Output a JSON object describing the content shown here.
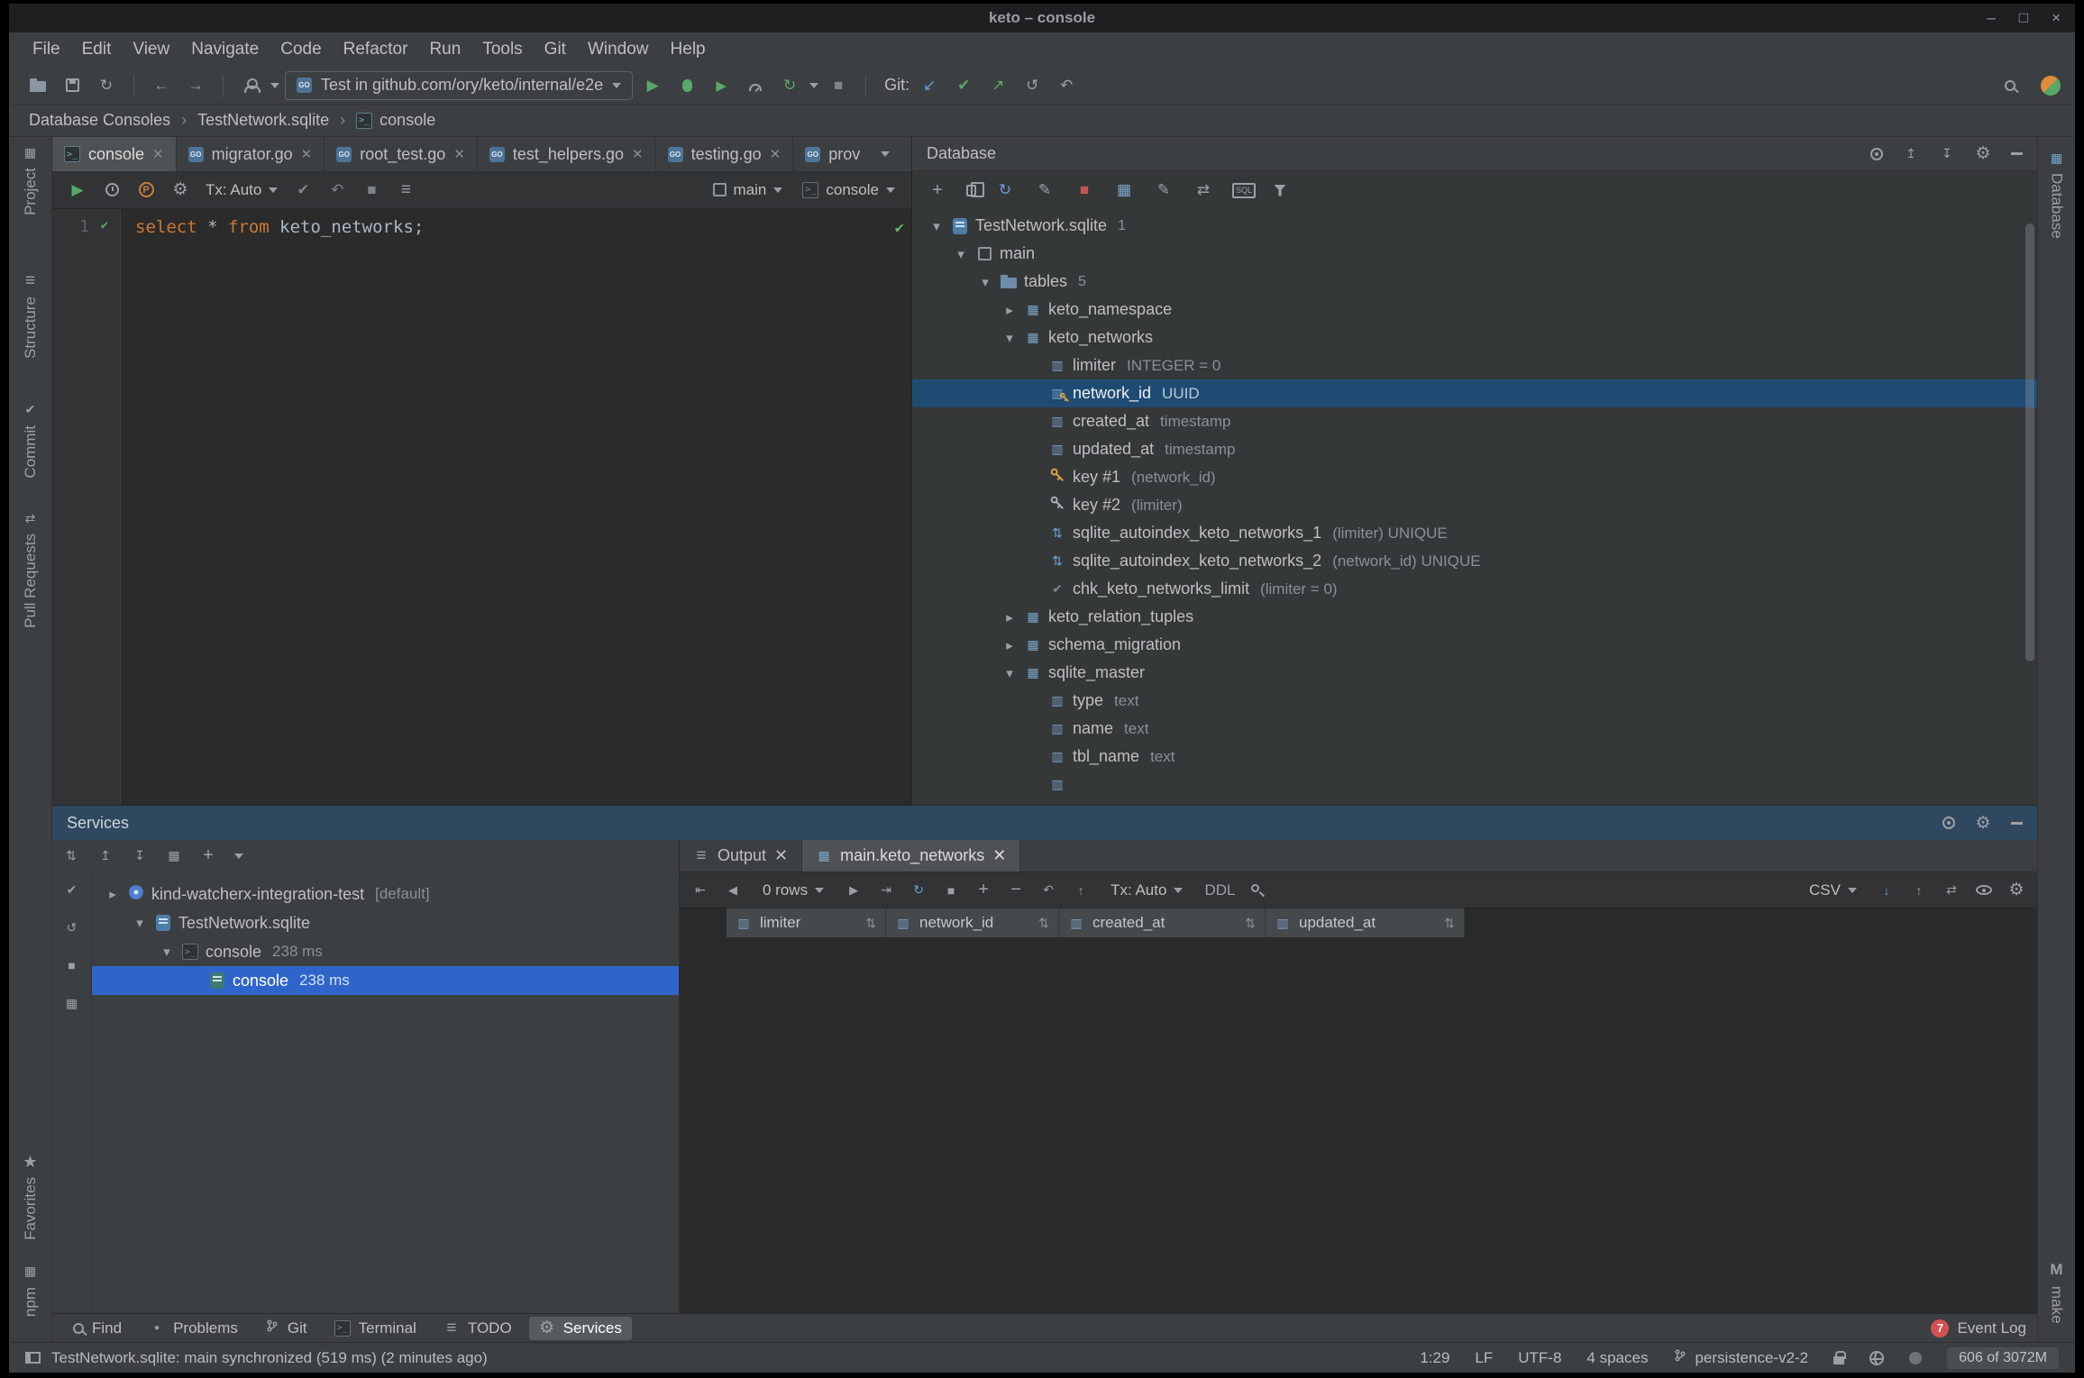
{
  "window": {
    "title": "keto – console",
    "controls": [
      "minimize",
      "maximize",
      "close"
    ]
  },
  "colors": {
    "selection_blue": "#2f65ca",
    "db_selection": "#1f4b73",
    "keyword_orange": "#cc7832",
    "success_green": "#59a869",
    "error_red": "#d25252",
    "key_gold": "#d9a343",
    "icon_blue": "#6a9fd8"
  },
  "menu": {
    "items": [
      "File",
      "Edit",
      "View",
      "Navigate",
      "Code",
      "Refactor",
      "Run",
      "Tools",
      "Git",
      "Window",
      "Help"
    ]
  },
  "toolbar": {
    "run_config": "Test in github.com/ory/keto/internal/e2e",
    "git_label": "Git:",
    "icon_names_left": [
      "open-icon",
      "save-all-icon",
      "sync-icon",
      "back-icon",
      "forward-icon",
      "profile-icon"
    ],
    "icon_names_run": [
      "run-icon",
      "debug-icon",
      "coverage-icon",
      "profiler-icon",
      "rerun-icon",
      "stop-icon"
    ],
    "icon_names_git": [
      "update-project-icon",
      "commit-icon",
      "push-icon",
      "history-icon",
      "rollback-icon"
    ],
    "icon_names_right": [
      "search-everywhere-icon",
      "avatar"
    ]
  },
  "breadcrumb": {
    "items": [
      "Database Consoles",
      "TestNetwork.sqlite",
      "console"
    ]
  },
  "left_stripe": {
    "items": [
      "Project",
      "Structure",
      "Commit",
      "Pull Requests"
    ],
    "bottom_items": [
      "Favorites",
      "npm"
    ]
  },
  "right_stripe": {
    "items": [
      "Database"
    ],
    "bottom_items": [
      "make"
    ]
  },
  "editor": {
    "tabs": [
      {
        "label": "console"
      },
      {
        "label": "migrator.go"
      },
      {
        "label": "root_test.go"
      },
      {
        "label": "test_helpers.go"
      },
      {
        "label": "testing.go"
      },
      {
        "label": "prov"
      }
    ],
    "toolbar": {
      "tx": "Tx: Auto",
      "schema": "main",
      "session": "console"
    },
    "code": {
      "line_number": "1",
      "kw1": "select ",
      "star": "* ",
      "kw2": "from ",
      "rest": "keto_networks;"
    }
  },
  "database": {
    "title": "Database",
    "toolbar_icon_names": [
      "add-icon",
      "copy-icon",
      "refresh-icon",
      "edit-icon",
      "stop-icon",
      "data-editor-icon",
      "modify-icon",
      "jump-to-console-icon",
      "sql-generator-icon",
      "filter-icon"
    ],
    "header_icon_names": [
      "tool-window-options-icon",
      "expand-all-icon",
      "collapse-all-icon",
      "settings-icon",
      "hide-icon"
    ],
    "tree": [
      {
        "name": "TestNetwork.sqlite",
        "badge": "1"
      },
      {
        "name": "main"
      },
      {
        "name": "tables",
        "badge": "5"
      },
      {
        "name": "keto_namespace"
      },
      {
        "name": "keto_networks"
      },
      {
        "name": "limiter",
        "meta": "INTEGER = 0"
      },
      {
        "name": "network_id",
        "meta": "UUID"
      },
      {
        "name": "created_at",
        "meta": "timestamp"
      },
      {
        "name": "updated_at",
        "meta": "timestamp"
      },
      {
        "name": "key #1",
        "meta": "(network_id)"
      },
      {
        "name": "key #2",
        "meta": "(limiter)"
      },
      {
        "name": "sqlite_autoindex_keto_networks_1",
        "meta": "(limiter) UNIQUE"
      },
      {
        "name": "sqlite_autoindex_keto_networks_2",
        "meta": "(network_id) UNIQUE"
      },
      {
        "name": "chk_keto_networks_limit",
        "meta": "(limiter = 0)"
      },
      {
        "name": "keto_relation_tuples"
      },
      {
        "name": "schema_migration"
      },
      {
        "name": "sqlite_master"
      },
      {
        "name": "type",
        "meta": "text"
      },
      {
        "name": "name",
        "meta": "text"
      },
      {
        "name": "tbl_name",
        "meta": "text"
      }
    ]
  },
  "services": {
    "title": "Services",
    "tree": [
      {
        "name": "kind-watcherx-integration-test",
        "meta": "[default]"
      },
      {
        "name": "TestNetwork.sqlite"
      },
      {
        "name": "console",
        "meta": "238 ms"
      },
      {
        "name": "console",
        "meta": "238 ms"
      }
    ],
    "output_tabs": [
      {
        "label": "Output"
      },
      {
        "label": "main.keto_networks"
      }
    ],
    "grid": {
      "rows_label": "0 rows",
      "tx": "Tx: Auto",
      "ddl": "DDL",
      "csv": "CSV",
      "columns": [
        "limiter",
        "network_id",
        "created_at",
        "updated_at"
      ]
    }
  },
  "tool_bar": {
    "buttons": [
      "Find",
      "Problems",
      "Git",
      "Terminal",
      "TODO",
      "Services"
    ],
    "event_log_label": "Event Log",
    "event_log_badge": "7"
  },
  "status_bar": {
    "message": "TestNetwork.sqlite: main synchronized (519 ms) (2 minutes ago)",
    "position": "1:29",
    "line_sep": "LF",
    "encoding": "UTF-8",
    "indent": "4 spaces",
    "branch": "persistence-v2-2",
    "memory": "606 of 3072M"
  }
}
